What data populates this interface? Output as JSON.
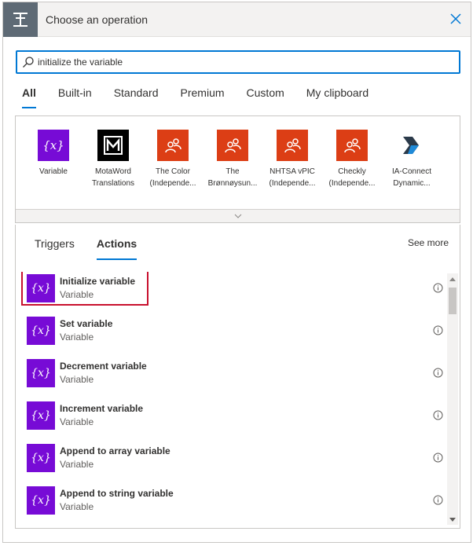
{
  "header": {
    "title": "Choose an operation"
  },
  "search": {
    "value": "initialize the variable"
  },
  "filter_tabs": [
    {
      "label": "All",
      "active": true
    },
    {
      "label": "Built-in"
    },
    {
      "label": "Standard"
    },
    {
      "label": "Premium"
    },
    {
      "label": "Custom"
    },
    {
      "label": "My clipboard"
    }
  ],
  "connectors": [
    {
      "line1": "Variable",
      "line2": "",
      "color": "#770bd6",
      "icon": "variable-icon"
    },
    {
      "line1": "MotaWord",
      "line2": "Translations",
      "color": "#000000",
      "icon": "motaword-icon"
    },
    {
      "line1": "The Color",
      "line2": "(Independe...",
      "color": "#dc3e15",
      "icon": "people-icon"
    },
    {
      "line1": "The",
      "line2": "Brønnøysun...",
      "color": "#dc3e15",
      "icon": "people-icon"
    },
    {
      "line1": "NHTSA vPIC",
      "line2": "(Independe...",
      "color": "#dc3e15",
      "icon": "people-icon"
    },
    {
      "line1": "Checkly",
      "line2": "(Independe...",
      "color": "#dc3e15",
      "icon": "people-icon"
    },
    {
      "line1": "IA-Connect",
      "line2": "Dynamic...",
      "color": "#ffffff",
      "icon": "ia-connect-icon"
    }
  ],
  "sub_tabs": [
    {
      "label": "Triggers"
    },
    {
      "label": "Actions",
      "active": true
    }
  ],
  "see_more": "See more",
  "actions": [
    {
      "name": "Initialize variable",
      "sub": "Variable",
      "highlighted": true
    },
    {
      "name": "Set variable",
      "sub": "Variable"
    },
    {
      "name": "Decrement variable",
      "sub": "Variable"
    },
    {
      "name": "Increment variable",
      "sub": "Variable"
    },
    {
      "name": "Append to array variable",
      "sub": "Variable"
    },
    {
      "name": "Append to string variable",
      "sub": "Variable"
    }
  ],
  "colors": {
    "accent": "#0078d4",
    "variable": "#770bd6",
    "connector": "#dc3e15",
    "highlight": "#c8102e"
  }
}
